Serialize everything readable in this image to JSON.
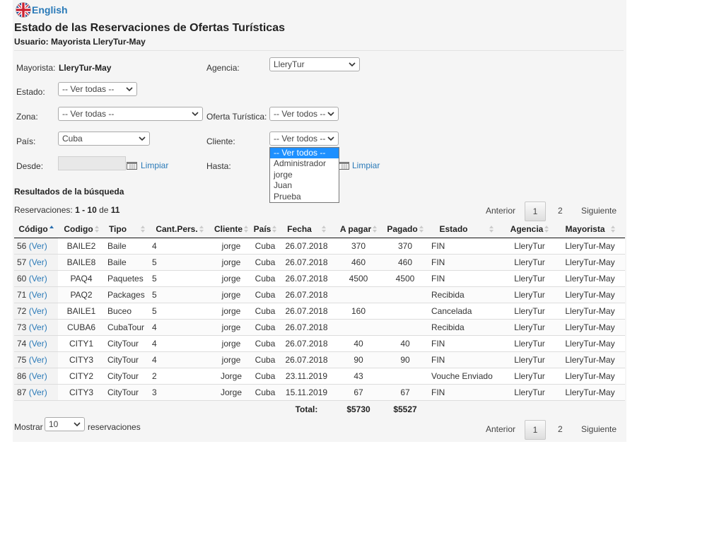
{
  "lang": {
    "label": "English",
    "icon": "uk-flag-icon"
  },
  "title": "Estado de las Reservaciones de Ofertas Turísticas",
  "subtitle": "Usuario: Mayorista LleryTur-May",
  "filters": {
    "mayorista_label": "Mayorista:",
    "mayorista_value": "LleryTur-May",
    "agencia_label": "Agencia:",
    "agencia_value": "LleryTur",
    "estado_label": "Estado:",
    "estado_value": "-- Ver todas --",
    "zona_label": "Zona:",
    "zona_value": "-- Ver todas --",
    "oferta_label": "Oferta Turística:",
    "oferta_value": "-- Ver todos --",
    "pais_label": "País:",
    "pais_value": "Cuba",
    "cliente_label": "Cliente:",
    "cliente_value": "-- Ver todos --",
    "desde_label": "Desde:",
    "hasta_label": "Hasta:",
    "limpiar": "Limpiar"
  },
  "cliente_dropdown": {
    "options": [
      "-- Ver todos --",
      "Administrador",
      "jorge",
      "Juan",
      "Prueba"
    ],
    "selected": "-- Ver todos --"
  },
  "results": {
    "heading": "Resultados de la búsqueda",
    "count_prefix": "Reservaciones:",
    "count_range": "1 - 10",
    "count_de": "de",
    "count_total": "11"
  },
  "pager": {
    "prev": "Anterior",
    "pages": [
      "1",
      "2"
    ],
    "current": "1",
    "next": "Siguiente"
  },
  "table": {
    "headers": [
      "Código",
      "Codigo",
      "Tipo",
      "Cant.Pers.",
      "Cliente",
      "País",
      "Fecha",
      "A pagar",
      "Pagado",
      "Estado",
      "Agencia",
      "Mayorista"
    ],
    "ver": "(Ver)",
    "rows": [
      {
        "id": "56",
        "codigo": "BAILE2",
        "tipo": "Baile",
        "cant": "4",
        "cliente": "jorge",
        "pais": "Cuba",
        "fecha": "26.07.2018",
        "apagar": "370",
        "pagado": "370",
        "estado": "FIN",
        "agencia": "LleryTur",
        "mayorista": "LleryTur-May"
      },
      {
        "id": "57",
        "codigo": "BAILE8",
        "tipo": "Baile",
        "cant": "5",
        "cliente": "jorge",
        "pais": "Cuba",
        "fecha": "26.07.2018",
        "apagar": "460",
        "pagado": "460",
        "estado": "FIN",
        "agencia": "LleryTur",
        "mayorista": "LleryTur-May"
      },
      {
        "id": "60",
        "codigo": "PAQ4",
        "tipo": "Paquetes",
        "cant": "5",
        "cliente": "jorge",
        "pais": "Cuba",
        "fecha": "26.07.2018",
        "apagar": "4500",
        "pagado": "4500",
        "estado": "FIN",
        "agencia": "LleryTur",
        "mayorista": "LleryTur-May"
      },
      {
        "id": "71",
        "codigo": "PAQ2",
        "tipo": "Packages",
        "cant": "5",
        "cliente": "jorge",
        "pais": "Cuba",
        "fecha": "26.07.2018",
        "apagar": "",
        "pagado": "",
        "estado": "Recibida",
        "agencia": "LleryTur",
        "mayorista": "LleryTur-May"
      },
      {
        "id": "72",
        "codigo": "BAILE1",
        "tipo": "Buceo",
        "cant": "5",
        "cliente": "jorge",
        "pais": "Cuba",
        "fecha": "26.07.2018",
        "apagar": "160",
        "pagado": "",
        "estado": "Cancelada",
        "agencia": "LleryTur",
        "mayorista": "LleryTur-May"
      },
      {
        "id": "73",
        "codigo": "CUBA6",
        "tipo": "CubaTour",
        "cant": "4",
        "cliente": "jorge",
        "pais": "Cuba",
        "fecha": "26.07.2018",
        "apagar": "",
        "pagado": "",
        "estado": "Recibida",
        "agencia": "LleryTur",
        "mayorista": "LleryTur-May"
      },
      {
        "id": "74",
        "codigo": "CITY1",
        "tipo": "CityTour",
        "cant": "4",
        "cliente": "jorge",
        "pais": "Cuba",
        "fecha": "26.07.2018",
        "apagar": "40",
        "pagado": "40",
        "estado": "FIN",
        "agencia": "LleryTur",
        "mayorista": "LleryTur-May"
      },
      {
        "id": "75",
        "codigo": "CITY3",
        "tipo": "CityTour",
        "cant": "4",
        "cliente": "jorge",
        "pais": "Cuba",
        "fecha": "26.07.2018",
        "apagar": "90",
        "pagado": "90",
        "estado": "FIN",
        "agencia": "LleryTur",
        "mayorista": "LleryTur-May"
      },
      {
        "id": "86",
        "codigo": "CITY2",
        "tipo": "CityTour",
        "cant": "2",
        "cliente": "Jorge",
        "pais": "Cuba",
        "fecha": "23.11.2019",
        "apagar": "43",
        "pagado": "",
        "estado": "Vouche Enviado",
        "agencia": "LleryTur",
        "mayorista": "LleryTur-May"
      },
      {
        "id": "87",
        "codigo": "CITY3",
        "tipo": "CityTour",
        "cant": "3",
        "cliente": "Jorge",
        "pais": "Cuba",
        "fecha": "15.11.2019",
        "apagar": "67",
        "pagado": "67",
        "estado": "FIN",
        "agencia": "LleryTur",
        "mayorista": "LleryTur-May"
      }
    ],
    "total_label": "Total:",
    "total_apagar": "$5730",
    "total_pagado": "$5527"
  },
  "footer": {
    "show_label": "Mostrar",
    "show_value": "10",
    "show_suffix": "reservaciones"
  },
  "colors": {
    "link": "#2a7ab8",
    "panel": "#f5f5f5",
    "highlight": "#1e90ff"
  }
}
